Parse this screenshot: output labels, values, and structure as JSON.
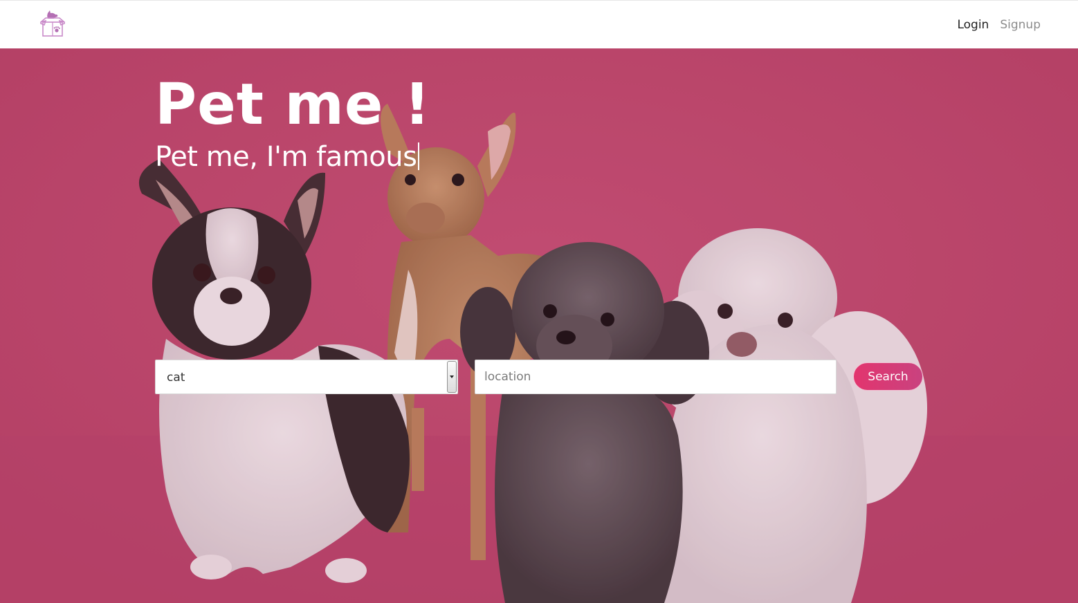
{
  "nav": {
    "login_label": "Login",
    "signup_label": "Signup"
  },
  "hero": {
    "title": "Pet me !",
    "subtitle": "Pet me, I'm famous"
  },
  "search": {
    "animal_selected": "cat",
    "location_placeholder": "location",
    "location_value": "",
    "button_label": "Search"
  },
  "colors": {
    "brand_pink": "#e2356e",
    "hero_background": "#bf4a6e",
    "logo_purple": "#b46fb4"
  },
  "icons": {
    "logo": "dog-in-box-paw-logo-icon",
    "select_arrow": "chevron-down-icon"
  }
}
